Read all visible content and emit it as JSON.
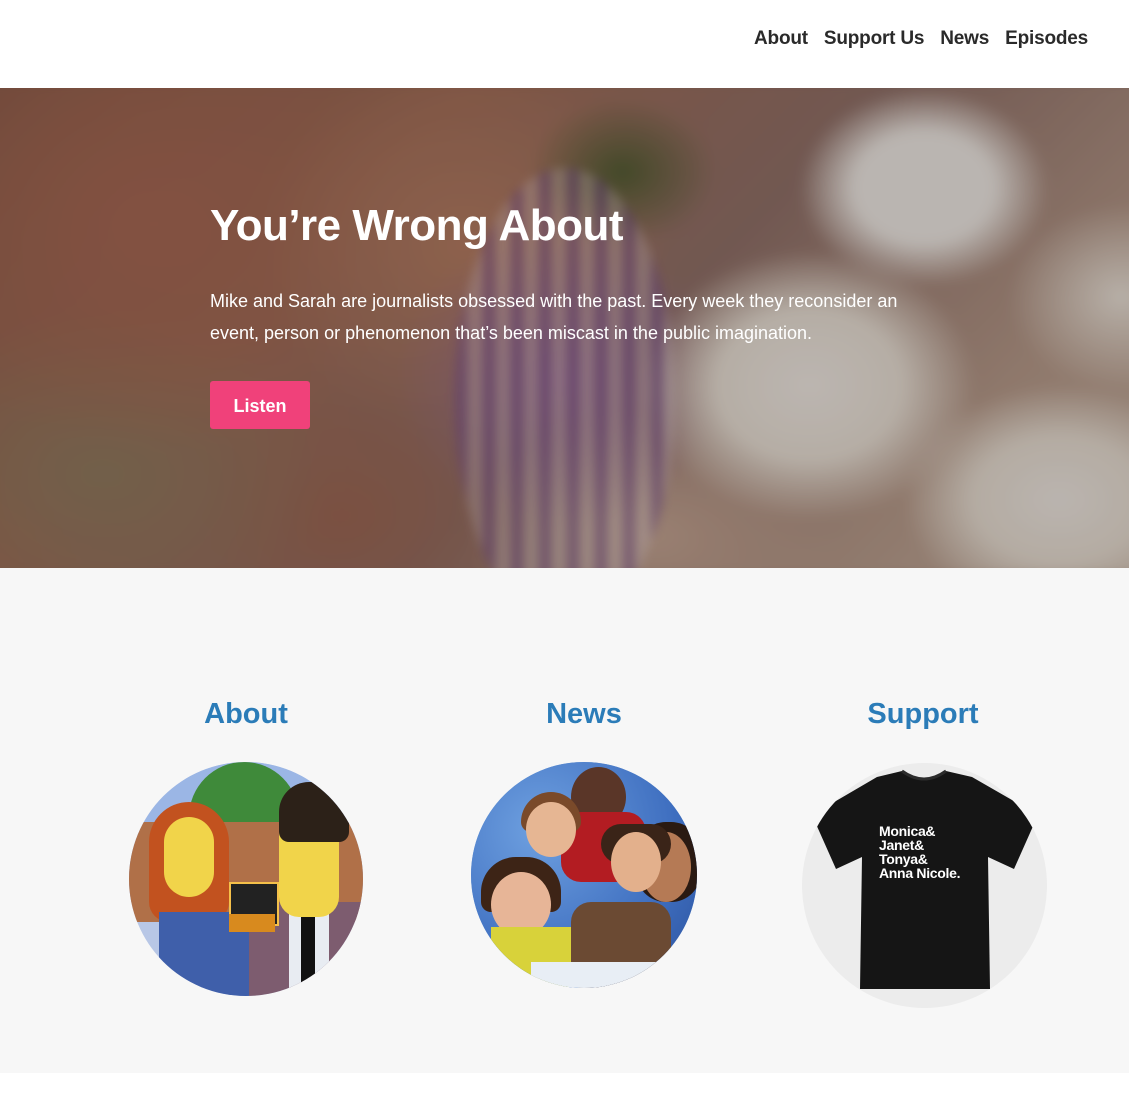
{
  "nav": {
    "items": [
      {
        "label": "About"
      },
      {
        "label": "Support Us"
      },
      {
        "label": "News"
      },
      {
        "label": "Episodes"
      }
    ]
  },
  "hero": {
    "title": "You’re Wrong About",
    "description": "Mike and Sarah are journalists obsessed with the past. Every week they reconsider an event, person or phenomenon that’s been miscast in the public imagination.",
    "button_label": "Listen"
  },
  "features": [
    {
      "title": "About"
    },
    {
      "title": "News"
    },
    {
      "title": "Support"
    }
  ],
  "tshirt_lines": [
    "Monica&",
    "Janet&",
    "Tonya&",
    "Anna Nicole."
  ],
  "colors": {
    "accent_pink": "#f0417a",
    "link_blue": "#2b7cb8",
    "nav_text": "#2a2a2a",
    "section_bg": "#f7f7f7"
  }
}
